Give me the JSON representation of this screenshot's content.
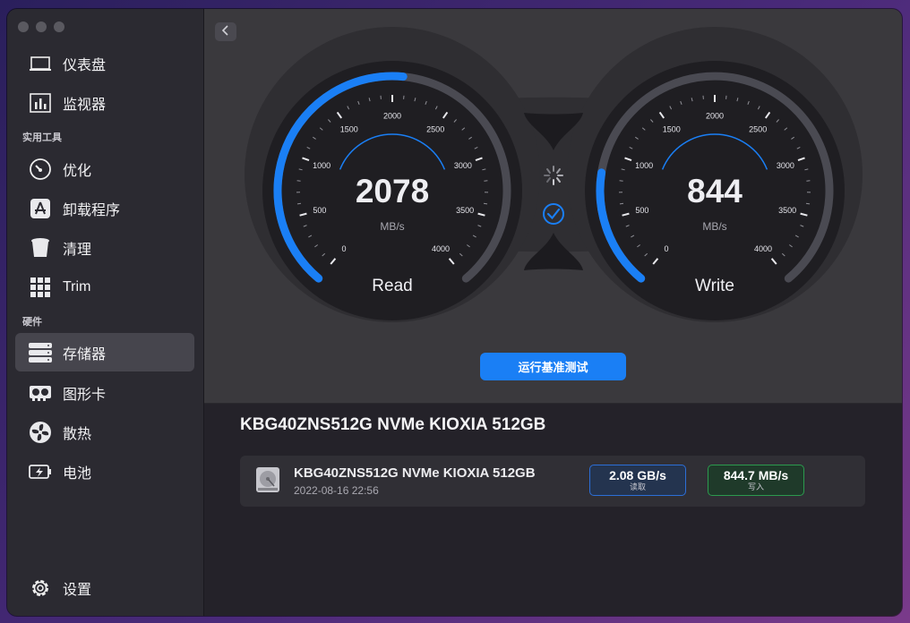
{
  "sidebar": {
    "items": [
      {
        "label": "仪表盘",
        "icon": "laptop-icon"
      },
      {
        "label": "监视器",
        "icon": "chart-icon"
      },
      {
        "label": "优化",
        "icon": "speedometer-icon"
      },
      {
        "label": "卸载程序",
        "icon": "app-store-icon"
      },
      {
        "label": "清理",
        "icon": "trash-icon"
      },
      {
        "label": "Trim",
        "icon": "grid-icon"
      },
      {
        "label": "存储器",
        "icon": "storage-icon"
      },
      {
        "label": "图形卡",
        "icon": "gpu-icon"
      },
      {
        "label": "散热",
        "icon": "fan-icon"
      },
      {
        "label": "电池",
        "icon": "battery-icon"
      }
    ],
    "section_tools": "实用工具",
    "section_hardware": "硬件",
    "settings_label": "设置"
  },
  "gauges": {
    "read": {
      "value": "2078",
      "unit": "MB/s",
      "label": "Read",
      "level": 2078
    },
    "write": {
      "value": "844",
      "unit": "MB/s",
      "label": "Write",
      "level": 844
    },
    "max": 4000,
    "ticks": [
      "0",
      "500",
      "1000",
      "1500",
      "2000",
      "2500",
      "3000",
      "3500",
      "4000"
    ]
  },
  "run_button": "运行基准测试",
  "disk": {
    "title": "KBG40ZNS512G NVMe KIOXIA 512GB",
    "row_name": "KBG40ZNS512G NVMe KIOXIA 512GB",
    "date": "2022-08-16 22:56",
    "read_value": "2.08 GB/s",
    "read_label": "读取",
    "write_value": "844.7 MB/s",
    "write_label": "写入"
  },
  "colors": {
    "accent": "#1a7ff5",
    "read_border": "#2c6ed6",
    "write_border": "#2c9a4e"
  }
}
